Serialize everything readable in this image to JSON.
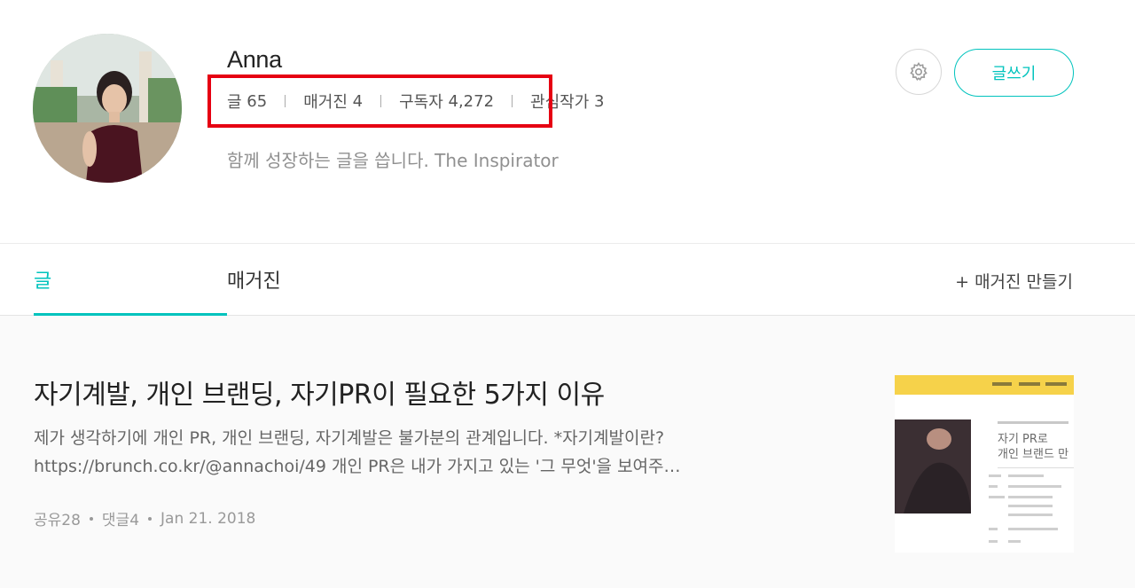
{
  "profile": {
    "name": "Anna",
    "stats": [
      {
        "label": "글",
        "count": "65"
      },
      {
        "label": "매거진",
        "count": "4"
      },
      {
        "label": "구독자",
        "count": "4,272"
      },
      {
        "label": "관심작가",
        "count": "3"
      }
    ],
    "bio": "함께 성장하는 글을 씁니다. The Inspirator",
    "settings_icon": "gear-icon",
    "write_button": "글쓰기"
  },
  "tabs": {
    "items": [
      {
        "label": "글",
        "active": true
      },
      {
        "label": "매거진",
        "active": false
      }
    ],
    "make_magazine": "+ 매거진 만들기"
  },
  "article": {
    "title": "자기계발, 개인 브랜딩, 자기PR이 필요한 5가지 이유",
    "excerpt": "제가 생각하기에 개인 PR, 개인 브랜딩, 자기계발은 불가분의 관계입니다. *자기계발이란? https://brunch.co.kr/@annachoi/49 개인 PR은 내가 가지고 있는 '그 무엇'을 보여주…",
    "shares": "공유28",
    "comments": "댓글4",
    "date": "Jan 21. 2018",
    "thumbnail": {
      "title_line1": "자기 PR로",
      "title_line2": "개인 브랜드 만"
    }
  },
  "colors": {
    "accent": "#00c3bd",
    "highlight": "#e60012"
  }
}
